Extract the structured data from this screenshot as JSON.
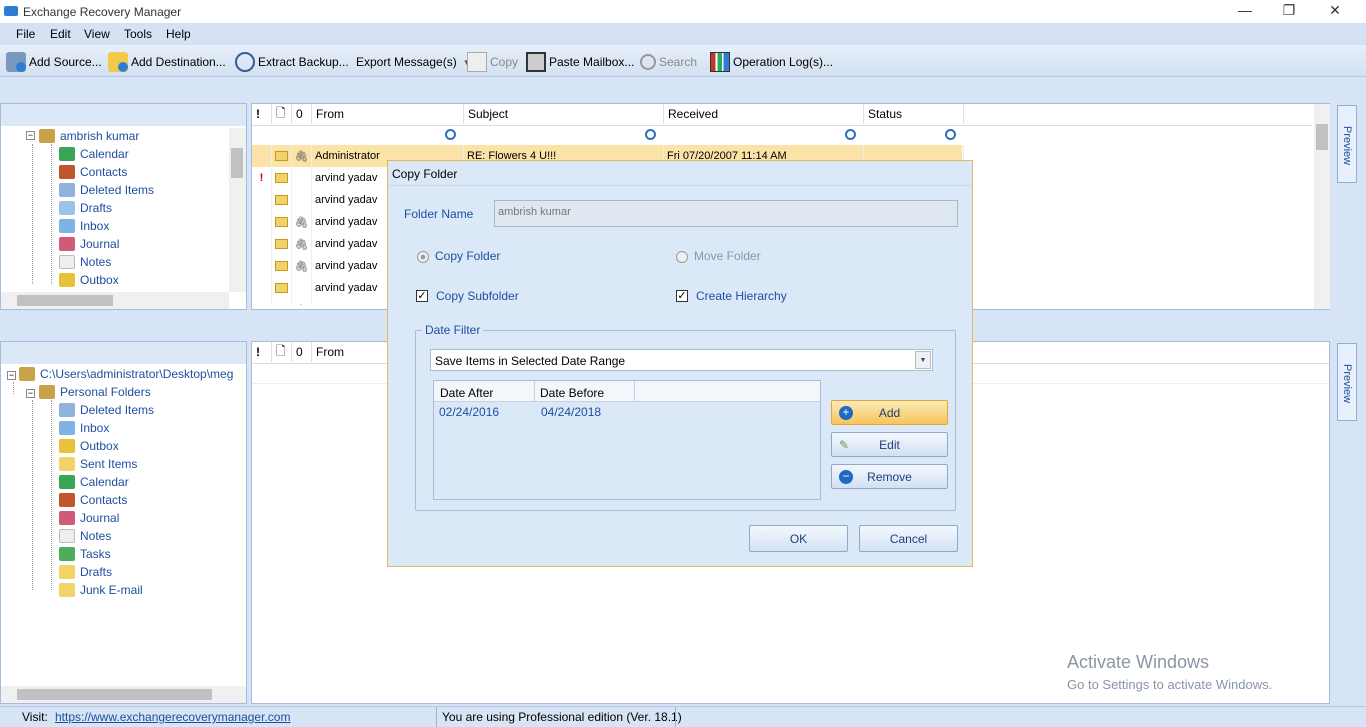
{
  "window": {
    "title": "Exchange Recovery Manager",
    "minimize": "—",
    "maximize": "❐",
    "close": "✕"
  },
  "menu": [
    "File",
    "Edit",
    "View",
    "Tools",
    "Help"
  ],
  "toolbar": {
    "add_source": "Add Source...",
    "add_destination": "Add Destination...",
    "extract_backup": "Extract Backup...",
    "export_messages": "Export Message(s)",
    "copy": "Copy",
    "paste_mailbox": "Paste Mailbox...",
    "search": "Search",
    "operation_logs": "Operation Log(s)..."
  },
  "source_tree": {
    "root": "ambrish kumar",
    "items": [
      "Calendar",
      "Contacts",
      "Deleted Items",
      "Drafts",
      "Inbox",
      "Journal",
      "Notes",
      "Outbox"
    ]
  },
  "dest_tree": {
    "path": "C:\\Users\\administrator\\Desktop\\meg",
    "root": "Personal Folders",
    "items": [
      "Deleted Items",
      "Inbox",
      "Outbox",
      "Sent Items",
      "Calendar",
      "Contacts",
      "Journal",
      "Notes",
      "Tasks",
      "Drafts",
      "Junk E-mail"
    ]
  },
  "message_list": {
    "headers": {
      "importance": "!",
      "type": "🗋",
      "attach": "0",
      "from": "From",
      "subject": "Subject",
      "received": "Received",
      "status": "Status"
    },
    "rows": [
      {
        "from": "Administrator",
        "subject": "RE: Flowers 4 U!!!",
        "received": "Fri 07/20/2007 11:14 AM",
        "important": false,
        "attach": true,
        "selected": true
      },
      {
        "from": "arvind yadav",
        "subject": "",
        "received": "",
        "important": true,
        "attach": false,
        "selected": false
      },
      {
        "from": "arvind yadav",
        "subject": "",
        "received": "",
        "important": false,
        "attach": false,
        "selected": false
      },
      {
        "from": "arvind yadav",
        "subject": "",
        "received": "",
        "important": false,
        "attach": true,
        "selected": false
      },
      {
        "from": "arvind yadav",
        "subject": "",
        "received": "",
        "important": false,
        "attach": true,
        "selected": false
      },
      {
        "from": "arvind yadav",
        "subject": "",
        "received": "",
        "important": false,
        "attach": true,
        "selected": false
      },
      {
        "from": "arvind yadav",
        "subject": "",
        "received": "",
        "important": false,
        "attach": false,
        "selected": false
      },
      {
        "from": "arvind yadav",
        "subject": "",
        "received": "",
        "important": false,
        "attach": true,
        "selected": false
      }
    ]
  },
  "lower_list": {
    "headers": {
      "importance": "!",
      "type": "🗋",
      "attach": "0",
      "from": "From"
    }
  },
  "preview_label": "Preview",
  "dialog": {
    "title": "Copy Folder",
    "folder_name_label": "Folder Name",
    "folder_name_value": "ambrish kumar",
    "copy_folder": "Copy Folder",
    "move_folder": "Move Folder",
    "copy_subfolder": "Copy Subfolder",
    "create_hierarchy": "Create Hierarchy",
    "date_filter": "Date Filter",
    "date_filter_option": "Save Items in Selected Date Range",
    "col_after": "Date After",
    "col_before": "Date Before",
    "date_after": "02/24/2016",
    "date_before": "04/24/2018",
    "add": "Add",
    "edit": "Edit",
    "remove": "Remove",
    "ok": "OK",
    "cancel": "Cancel"
  },
  "status": {
    "visit_label": "Visit:",
    "url": "https://www.exchangerecoverymanager.com",
    "edition": "You are using Professional edition (Ver. 18.1)"
  },
  "watermark": {
    "line1": "Activate Windows",
    "line2": "Go to Settings to activate Windows."
  },
  "colors": {
    "accent": "#1e4fa0",
    "selected_row": "#fbe3a8",
    "dialog_bg": "#dbe8f7",
    "toolbar_bg": "#d5e2f3"
  }
}
